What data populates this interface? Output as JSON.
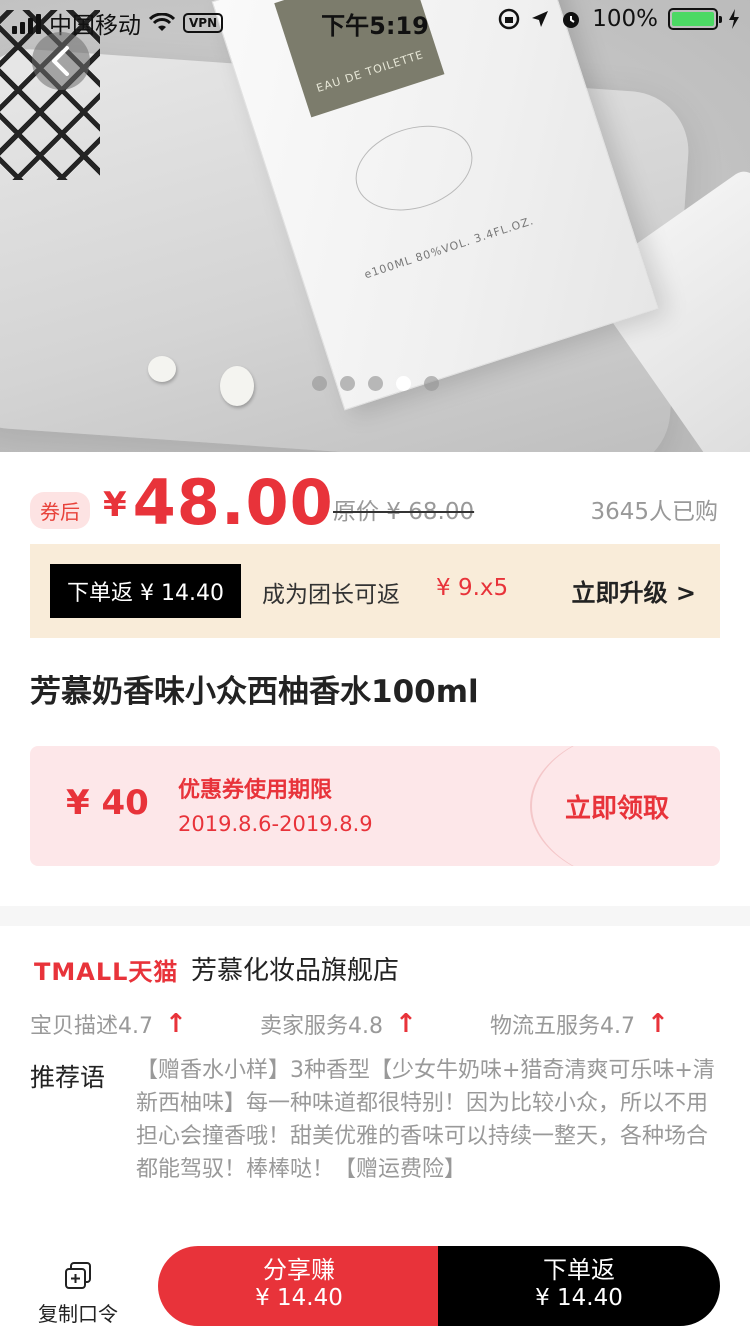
{
  "status_bar": {
    "carrier": "中国移动",
    "vpn": "VPN",
    "time": "下午5:19",
    "battery": "100%"
  },
  "gallery": {
    "box_label": "EAU DE TOILETTE",
    "box_spec": "e100ML  80%VOL.  3.4FL.OZ.",
    "total": 5,
    "active_index": 3
  },
  "price": {
    "coupon_tag": "券后",
    "currency": "¥",
    "value": "48.00",
    "original": "原价 ¥ 68.00",
    "sold": "3645人已购"
  },
  "rebate": {
    "tag": "下单返 ¥ 14.40",
    "text": "成为团长可返",
    "amount": "¥ 9.x5",
    "upgrade": "立即升级 >"
  },
  "product": {
    "title": "芳慕奶香味小众西柚香水100ml"
  },
  "coupon": {
    "amount": "¥ 40",
    "title": "优惠券使用期限",
    "date_range": "2019.8.6-2019.8.9",
    "claim": "立即领取"
  },
  "shop": {
    "platform": "TMALL天猫",
    "name": "芳慕化妆品旗舰店",
    "ratings": [
      {
        "label": "宝贝描述4.7"
      },
      {
        "label": "卖家服务4.8"
      },
      {
        "label": "物流五服务4.7"
      }
    ],
    "rec_label": "推荐语",
    "rec_text": "【赠香水小样】3种香型【少女牛奶味+猎奇清爽可乐味+清新西柚味】每一种味道都很特别！因为比较小众，所以不用担心会撞香哦！甜美优雅的香味可以持续一整天，各种场合都能驾驭！棒棒哒！【赠运费险】"
  },
  "bottom_bar": {
    "copy_label": "复制口令",
    "share": {
      "line1": "分享赚",
      "line2": "¥ 14.40"
    },
    "order": {
      "line1": "下单返",
      "line2": "¥ 14.40"
    }
  },
  "colors": {
    "accent_red": "#e8333a",
    "rebate_bg": "#f9ecd9",
    "coupon_bg": "#fde7e9"
  }
}
